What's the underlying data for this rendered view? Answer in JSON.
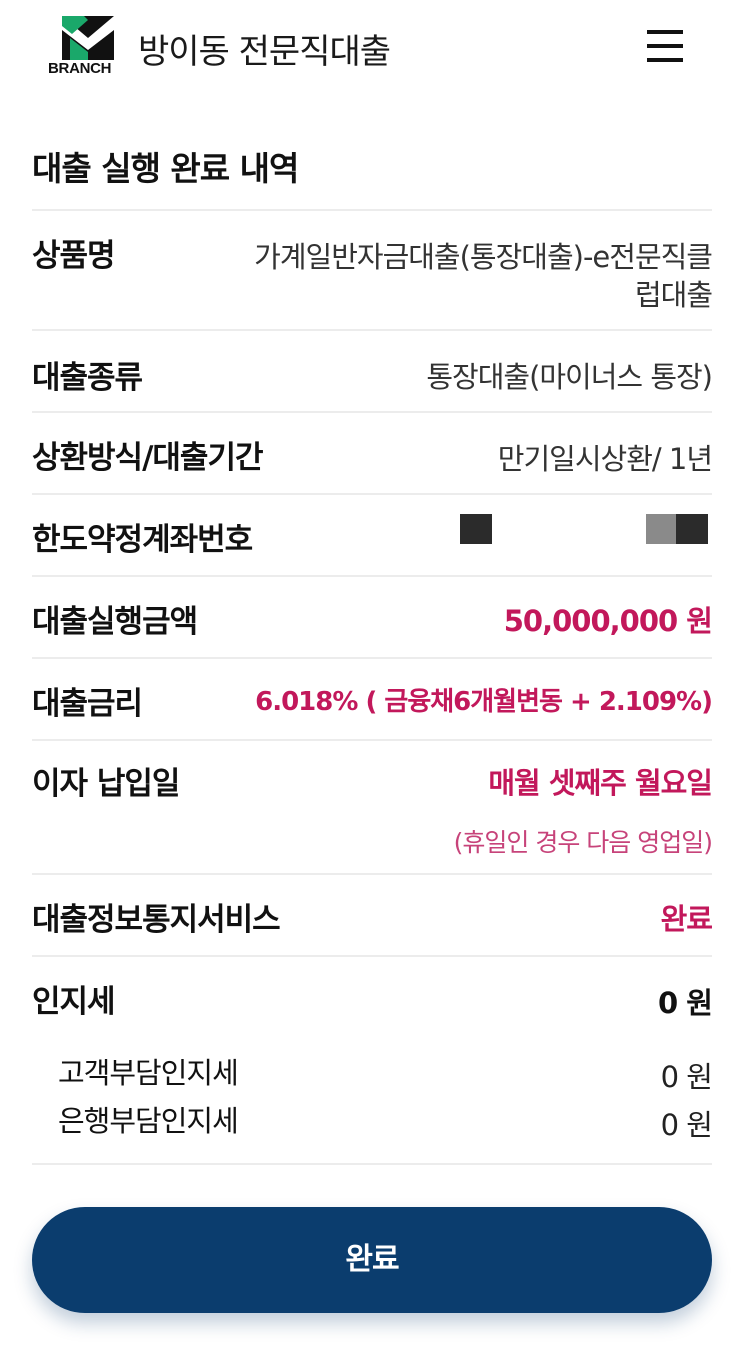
{
  "header": {
    "logo_text": "BRANCH",
    "branch_name": "방이동 전문직대출",
    "logo_color": "#1aa86a"
  },
  "section_title": "대출 실행 완료 내역",
  "rows": {
    "product": {
      "label": "상품명",
      "value_line1": "가계일반자금대출(통장대출)-e전문직클",
      "value_line2": "럽대출"
    },
    "loan_type": {
      "label": "대출종류",
      "value": "통장대출(마이너스 통장)"
    },
    "repayment": {
      "label": "상환방식/대출기간",
      "value": "만기일시상환/ 1년"
    },
    "account": {
      "label": "한도약정계좌번호"
    },
    "amount": {
      "label": "대출실행금액",
      "value": "50,000,000 원"
    },
    "rate": {
      "label": "대출금리",
      "value": "6.018% ( 금융채6개월변동 + 2.109%)"
    },
    "interest_date": {
      "label": "이자 납입일",
      "value": "매월 셋째주 월요일",
      "note": "(휴일인 경우 다음 영업일)"
    },
    "notification": {
      "label": "대출정보통지서비스",
      "value": "완료"
    },
    "stamp_tax": {
      "label": "인지세",
      "value": "0 원",
      "customer_label": "고객부담인지세",
      "customer_value": "0 원",
      "bank_label": "은행부담인지세",
      "bank_value": "0 원"
    }
  },
  "button": {
    "label": "완료"
  },
  "colors": {
    "accent": "#c2185b",
    "button": "#0b3d6e"
  }
}
